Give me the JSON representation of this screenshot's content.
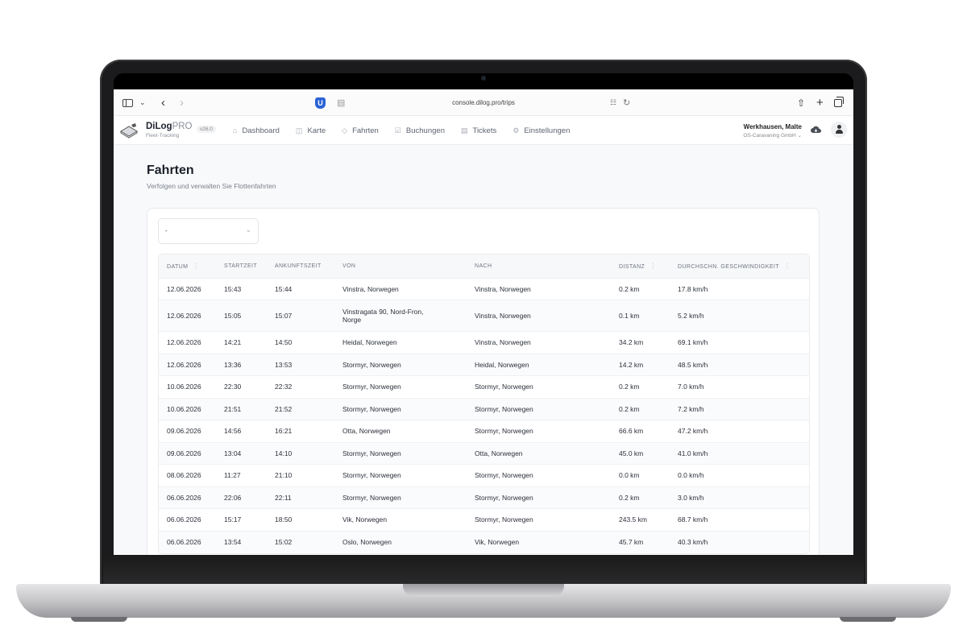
{
  "browser": {
    "url": "console.dilog.pro/trips"
  },
  "app": {
    "brand_name": "DiLog",
    "brand_suffix": "PRO",
    "brand_sub": "Fleet-Tracking",
    "version": "v26.0",
    "nav": [
      {
        "label": "Dashboard",
        "icon": "home-icon"
      },
      {
        "label": "Karte",
        "icon": "map-icon"
      },
      {
        "label": "Fahrten",
        "icon": "route-icon"
      },
      {
        "label": "Buchungen",
        "icon": "calendar-check-icon"
      },
      {
        "label": "Tickets",
        "icon": "ticket-icon"
      },
      {
        "label": "Einstellungen",
        "icon": "gear-icon"
      }
    ],
    "user_name": "Werkhausen, Malte",
    "user_org": "OS-Caravaning GmbH"
  },
  "page": {
    "title": "Fahrten",
    "subtitle": "Verfolgen und verwalten Sie Flottenfahrten"
  },
  "filter": {
    "value": "-"
  },
  "table": {
    "headers": [
      "DATUM",
      "STARTZEIT",
      "ANKUNFTSZEIT",
      "VON",
      "NACH",
      "DISTANZ",
      "DURCHSCHN. GESCHWINDIGKEIT"
    ],
    "rows": [
      {
        "datum": "12.06.2026",
        "start": "15:43",
        "ankunft": "15:44",
        "von": "Vinstra, Norwegen",
        "nach": "Vinstra, Norwegen",
        "distanz": "0.2 km",
        "speed": "17.8 km/h"
      },
      {
        "datum": "12.06.2026",
        "start": "15:05",
        "ankunft": "15:07",
        "von": "Vinstragata 90, Nord-Fron,",
        "von2": "Norge",
        "nach": "Vinstra, Norwegen",
        "distanz": "0.1 km",
        "speed": "5.2 km/h"
      },
      {
        "datum": "12.06.2026",
        "start": "14:21",
        "ankunft": "14:50",
        "von": "Heidal, Norwegen",
        "nach": "Vinstra, Norwegen",
        "distanz": "34.2 km",
        "speed": "69.1 km/h"
      },
      {
        "datum": "12.06.2026",
        "start": "13:36",
        "ankunft": "13:53",
        "von": "Stormyr, Norwegen",
        "nach": "Heidal, Norwegen",
        "distanz": "14.2 km",
        "speed": "48.5 km/h"
      },
      {
        "datum": "10.06.2026",
        "start": "22:30",
        "ankunft": "22:32",
        "von": "Stormyr, Norwegen",
        "nach": "Stormyr, Norwegen",
        "distanz": "0.2 km",
        "speed": "7.0 km/h"
      },
      {
        "datum": "10.06.2026",
        "start": "21:51",
        "ankunft": "21:52",
        "von": "Stormyr, Norwegen",
        "nach": "Stormyr, Norwegen",
        "distanz": "0.2 km",
        "speed": "7.2 km/h"
      },
      {
        "datum": "09.06.2026",
        "start": "14:56",
        "ankunft": "16:21",
        "von": "Otta, Norwegen",
        "nach": "Stormyr, Norwegen",
        "distanz": "66.6 km",
        "speed": "47.2 km/h"
      },
      {
        "datum": "09.06.2026",
        "start": "13:04",
        "ankunft": "14:10",
        "von": "Stormyr, Norwegen",
        "nach": "Otta, Norwegen",
        "distanz": "45.0 km",
        "speed": "41.0 km/h"
      },
      {
        "datum": "08.06.2026",
        "start": "11:27",
        "ankunft": "21:10",
        "von": "Stormyr, Norwegen",
        "nach": "Stormyr, Norwegen",
        "distanz": "0.0 km",
        "speed": "0.0 km/h"
      },
      {
        "datum": "06.06.2026",
        "start": "22:06",
        "ankunft": "22:11",
        "von": "Stormyr, Norwegen",
        "nach": "Stormyr, Norwegen",
        "distanz": "0.2 km",
        "speed": "3.0 km/h"
      },
      {
        "datum": "06.06.2026",
        "start": "15:17",
        "ankunft": "18:50",
        "von": "Vik, Norwegen",
        "nach": "Stormyr, Norwegen",
        "distanz": "243.5 km",
        "speed": "68.7 km/h"
      },
      {
        "datum": "06.06.2026",
        "start": "13:54",
        "ankunft": "15:02",
        "von": "Oslo, Norwegen",
        "nach": "Vik, Norwegen",
        "distanz": "45.7 km",
        "speed": "40.3 km/h"
      }
    ]
  }
}
